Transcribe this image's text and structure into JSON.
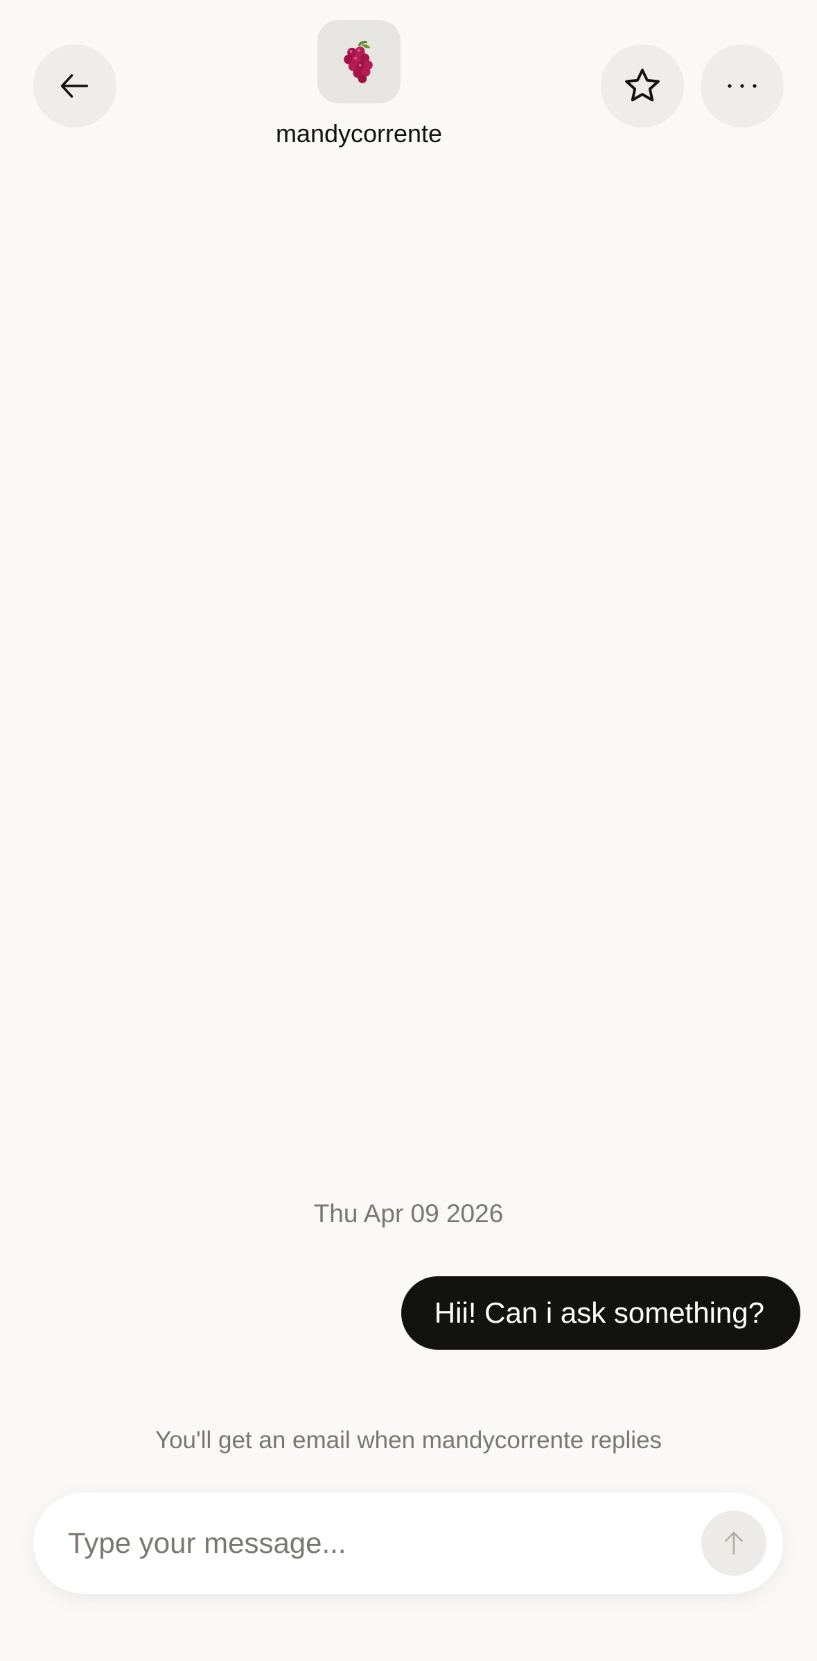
{
  "header": {
    "avatar_icon": "grapes-icon",
    "username": "mandycorrente"
  },
  "chat": {
    "date": "Thu Apr 09 2026",
    "messages": [
      {
        "from": "me",
        "text": "Hii! Can i ask something?"
      }
    ],
    "notice": "You'll get an email when mandycorrente replies"
  },
  "composer": {
    "placeholder": "Type your message...",
    "value": ""
  },
  "colors": {
    "background": "#faf9f7",
    "bubble": "#121210",
    "muted_text": "#7a7770",
    "button_bg": "#efedea"
  }
}
